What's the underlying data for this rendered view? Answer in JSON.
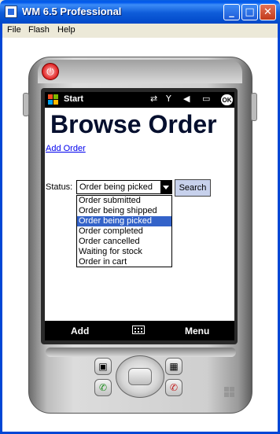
{
  "window": {
    "title": "WM 6.5 Professional",
    "minimize_icon": "minimize-icon",
    "maximize_icon": "maximize-icon",
    "close_icon": "close-icon"
  },
  "menu": {
    "items": [
      "File",
      "Flash",
      "Help"
    ]
  },
  "taskbar": {
    "start_label": "Start",
    "ok_label": "OK"
  },
  "page": {
    "heading": "Browse Order",
    "add_order_link": "Add Order",
    "status_label": "Status:",
    "status_selected": "Order being picked",
    "search_button": "Search",
    "status_options": [
      "Order submitted",
      "Order being shipped",
      "Order being picked",
      "Order completed",
      "Order cancelled",
      "Waiting for stock",
      "Order in cart"
    ],
    "selected_index": 2
  },
  "softkeys": {
    "left": "Add",
    "right": "Menu"
  },
  "colors": {
    "heading": "#050F2E",
    "link": "#0000EE",
    "selection": "#3463C9",
    "search_button": "#C7D1EC"
  }
}
